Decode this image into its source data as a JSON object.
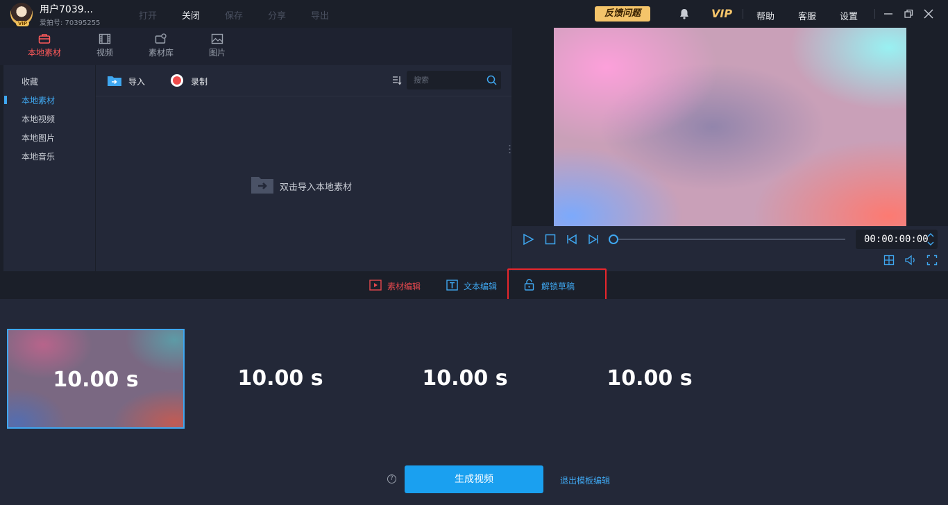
{
  "header": {
    "username": "用户7039...",
    "user_id": "爱拍号: 70395255",
    "avatar_badge": "VIP",
    "menu": [
      "打开",
      "关闭",
      "保存",
      "分享",
      "导出"
    ],
    "feedback_label": "反馈问题",
    "vip_label": "VIP",
    "links": [
      "帮助",
      "客服",
      "设置"
    ]
  },
  "tabs": [
    {
      "label": "本地素材",
      "icon": "toolbox-icon",
      "active": true
    },
    {
      "label": "视频",
      "icon": "film-icon"
    },
    {
      "label": "素材库",
      "icon": "library-icon"
    },
    {
      "label": "图片",
      "icon": "image-icon"
    }
  ],
  "sidebar": {
    "items": [
      {
        "label": "收藏"
      },
      {
        "label": "本地素材",
        "active": true
      },
      {
        "label": "本地视频"
      },
      {
        "label": "本地图片"
      },
      {
        "label": "本地音乐"
      }
    ]
  },
  "toolbar": {
    "import_label": "导入",
    "record_label": "录制",
    "search_placeholder": "搜索"
  },
  "content": {
    "empty_hint": "双击导入本地素材"
  },
  "player": {
    "timecode": "00:00:00:00",
    "progress": 0
  },
  "edit_tabs": [
    {
      "label": "素材编辑",
      "icon": "media-edit-icon",
      "color": "#e5484d"
    },
    {
      "label": "文本编辑",
      "icon": "text-edit-icon",
      "color": "#3fa7f0"
    },
    {
      "label": "解锁草稿",
      "icon": "unlock-icon",
      "color": "#3fa7f0"
    }
  ],
  "clips": [
    {
      "duration": "10.00 s",
      "selected": true
    },
    {
      "duration": "10.00 s"
    },
    {
      "duration": "10.00 s"
    },
    {
      "duration": "10.00 s"
    }
  ],
  "footer": {
    "generate_label": "生成视频",
    "exit_label": "退出模板编辑"
  },
  "colors": {
    "accent": "#1aa0f0",
    "active_tab": "#ff5a5a",
    "highlight": "#e8262c",
    "feedback": "#f4c46a"
  }
}
